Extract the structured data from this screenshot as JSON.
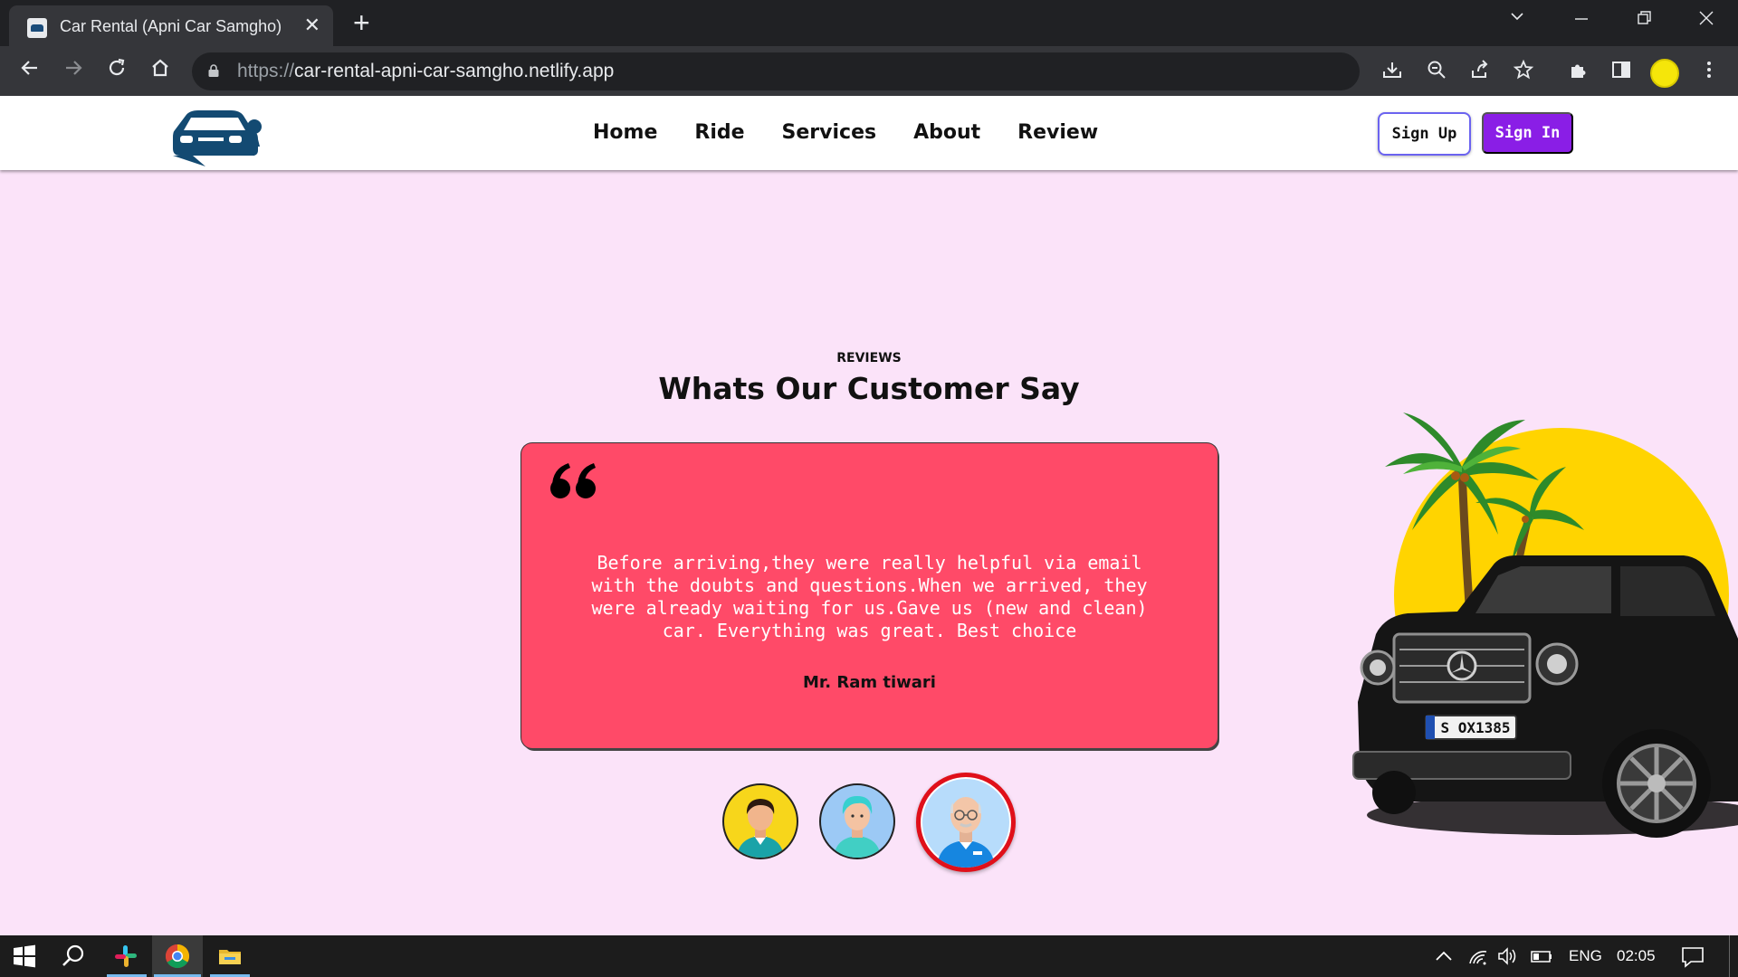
{
  "browser": {
    "tab_title": "Car Rental (Apni Car Samgho)",
    "url_scheme": "https://",
    "url_host": "car-rental-apni-car-samgho.netlify.app"
  },
  "site": {
    "nav": [
      "Home",
      "Ride",
      "Services",
      "About",
      "Review"
    ],
    "signup_label": "Sign Up",
    "signin_label": "Sign In",
    "accent": "#8a1ee6",
    "page_bg": "#fbe3f9"
  },
  "reviews": {
    "eyebrow": "REVIEWS",
    "heading": "Whats Our Customer Say",
    "card_color": "#ff4a68",
    "quote_icon": "quote-icon",
    "text": "Before arriving,they were really helpful via email with the doubts and questions.When we arrived, they were already waiting for us.Gave us (new and clean) car. Everything was great. Best choice",
    "reviewer": "Mr. Ram tiwari",
    "selected_avatar": 3
  },
  "taskbar": {
    "language": "ENG",
    "time": "02:05"
  }
}
